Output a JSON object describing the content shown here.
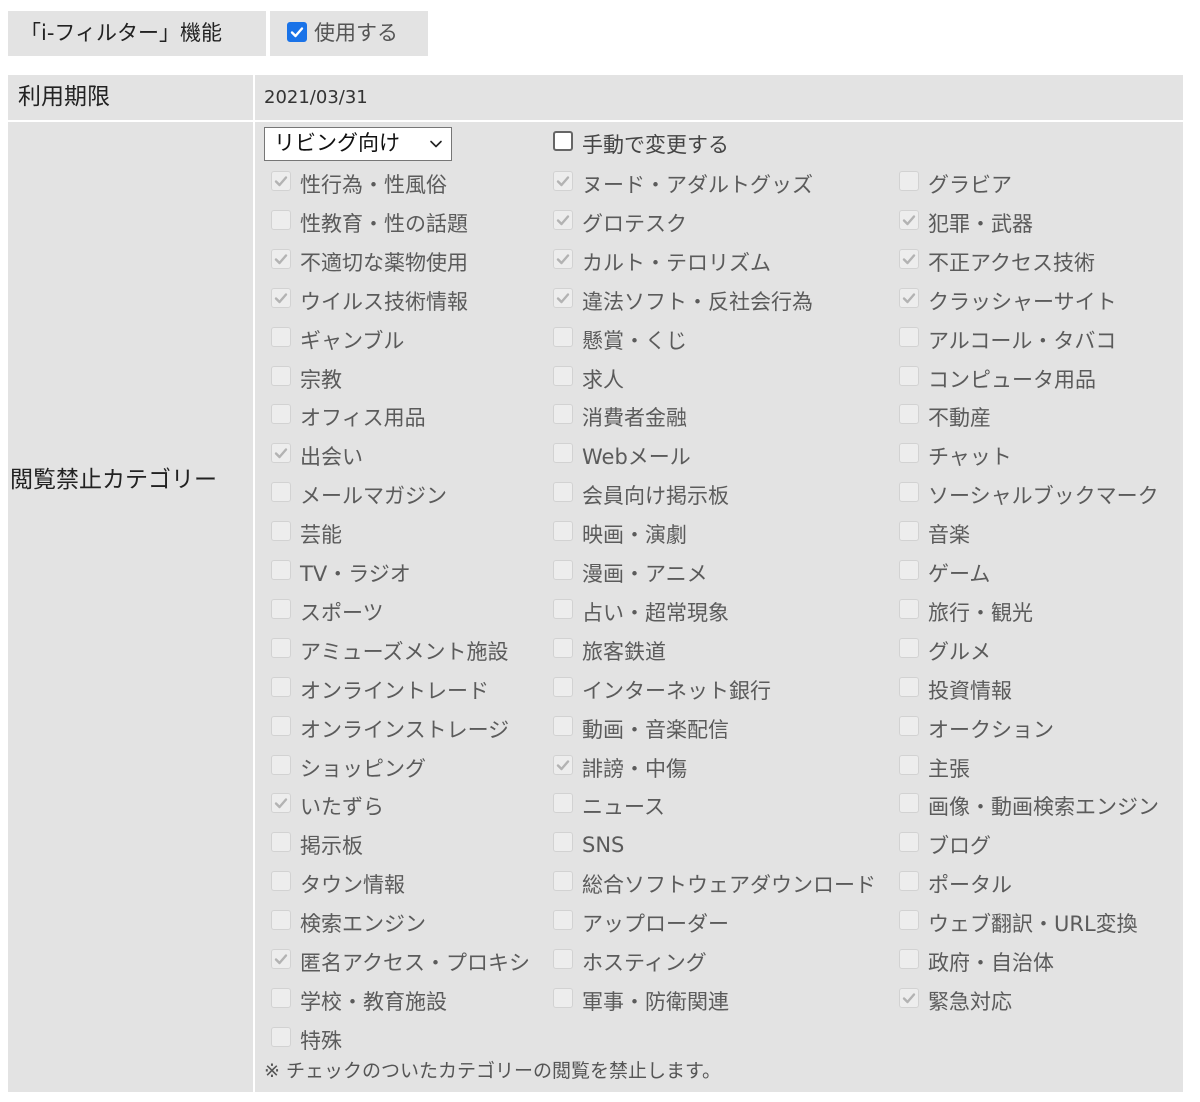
{
  "filter_feature": {
    "label": "「i-フィルター」機能",
    "use_checkbox": {
      "checked": true,
      "label": "使用する"
    }
  },
  "expiry": {
    "label": "利用期限",
    "value": "2021/03/31"
  },
  "categories_section": {
    "label": "閲覧禁止カテゴリー",
    "preset_select": {
      "value": "リビング向け"
    },
    "manual_change": {
      "checked": false,
      "label": "手動で変更する"
    },
    "columns": [
      [
        {
          "label": "性行為・性風俗",
          "checked": true
        },
        {
          "label": "性教育・性の話題",
          "checked": false
        },
        {
          "label": "不適切な薬物使用",
          "checked": true
        },
        {
          "label": "ウイルス技術情報",
          "checked": true
        },
        {
          "label": "ギャンブル",
          "checked": false
        },
        {
          "label": "宗教",
          "checked": false
        },
        {
          "label": "オフィス用品",
          "checked": false
        },
        {
          "label": "出会い",
          "checked": true
        },
        {
          "label": "メールマガジン",
          "checked": false
        },
        {
          "label": "芸能",
          "checked": false
        },
        {
          "label": "TV・ラジオ",
          "checked": false
        },
        {
          "label": "スポーツ",
          "checked": false
        },
        {
          "label": "アミューズメント施設",
          "checked": false
        },
        {
          "label": "オンライントレード",
          "checked": false
        },
        {
          "label": "オンラインストレージ",
          "checked": false
        },
        {
          "label": "ショッピング",
          "checked": false
        },
        {
          "label": "いたずら",
          "checked": true
        },
        {
          "label": "掲示板",
          "checked": false
        },
        {
          "label": "タウン情報",
          "checked": false
        },
        {
          "label": "検索エンジン",
          "checked": false
        },
        {
          "label": "匿名アクセス・プロキシ",
          "checked": true
        },
        {
          "label": "学校・教育施設",
          "checked": false
        },
        {
          "label": "特殊",
          "checked": false
        }
      ],
      [
        {
          "label": "ヌード・アダルトグッズ",
          "checked": true
        },
        {
          "label": "グロテスク",
          "checked": true
        },
        {
          "label": "カルト・テロリズム",
          "checked": true
        },
        {
          "label": "違法ソフト・反社会行為",
          "checked": true
        },
        {
          "label": "懸賞・くじ",
          "checked": false
        },
        {
          "label": "求人",
          "checked": false
        },
        {
          "label": "消費者金融",
          "checked": false
        },
        {
          "label": "Webメール",
          "checked": false
        },
        {
          "label": "会員向け掲示板",
          "checked": false
        },
        {
          "label": "映画・演劇",
          "checked": false
        },
        {
          "label": "漫画・アニメ",
          "checked": false
        },
        {
          "label": "占い・超常現象",
          "checked": false
        },
        {
          "label": "旅客鉄道",
          "checked": false
        },
        {
          "label": "インターネット銀行",
          "checked": false
        },
        {
          "label": "動画・音楽配信",
          "checked": false
        },
        {
          "label": "誹謗・中傷",
          "checked": true
        },
        {
          "label": "ニュース",
          "checked": false
        },
        {
          "label": "SNS",
          "checked": false
        },
        {
          "label": "総合ソフトウェアダウンロード",
          "checked": false
        },
        {
          "label": "アップローダー",
          "checked": false
        },
        {
          "label": "ホスティング",
          "checked": false
        },
        {
          "label": "軍事・防衛関連",
          "checked": false
        }
      ],
      [
        {
          "label": "グラビア",
          "checked": false
        },
        {
          "label": "犯罪・武器",
          "checked": true
        },
        {
          "label": "不正アクセス技術",
          "checked": true
        },
        {
          "label": "クラッシャーサイト",
          "checked": true
        },
        {
          "label": "アルコール・タバコ",
          "checked": false
        },
        {
          "label": "コンピュータ用品",
          "checked": false
        },
        {
          "label": "不動産",
          "checked": false
        },
        {
          "label": "チャット",
          "checked": false
        },
        {
          "label": "ソーシャルブックマーク",
          "checked": false
        },
        {
          "label": "音楽",
          "checked": false
        },
        {
          "label": "ゲーム",
          "checked": false
        },
        {
          "label": "旅行・観光",
          "checked": false
        },
        {
          "label": "グルメ",
          "checked": false
        },
        {
          "label": "投資情報",
          "checked": false
        },
        {
          "label": "オークション",
          "checked": false
        },
        {
          "label": "主張",
          "checked": false
        },
        {
          "label": "画像・動画検索エンジン",
          "checked": false
        },
        {
          "label": "ブログ",
          "checked": false
        },
        {
          "label": "ポータル",
          "checked": false
        },
        {
          "label": "ウェブ翻訳・URL変換",
          "checked": false
        },
        {
          "label": "政府・自治体",
          "checked": false
        },
        {
          "label": "緊急対応",
          "checked": true
        }
      ]
    ],
    "note": "※ チェックのついたカテゴリーの閲覧を禁止します。"
  },
  "colors": {
    "cell_background": "#e3e3e3",
    "checkbox_active": "#1a73e8",
    "checkbox_disabled": "#ededed",
    "tick_disabled": "#b3b3b3"
  }
}
